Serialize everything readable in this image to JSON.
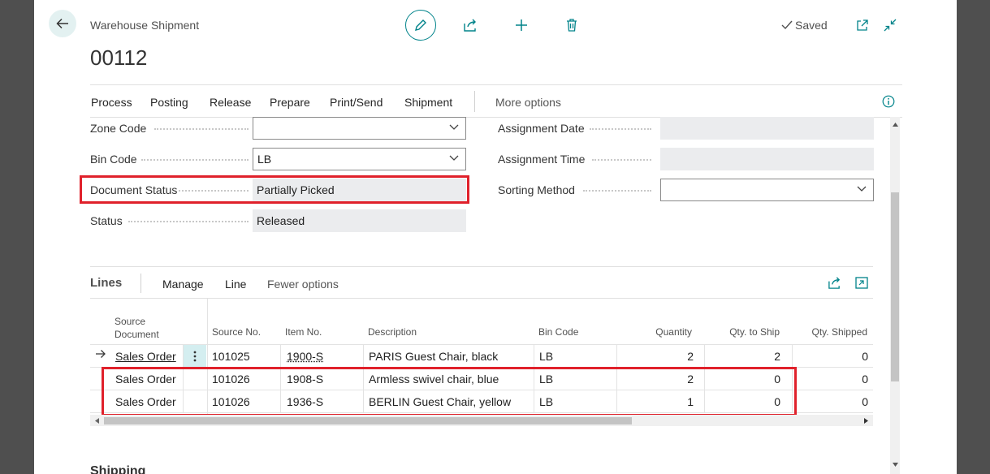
{
  "header": {
    "breadcrumb": "Warehouse Shipment",
    "document_no": "00112",
    "saved_label": "Saved"
  },
  "menu": {
    "items": [
      "Process",
      "Posting",
      "Release",
      "Prepare",
      "Print/Send",
      "Shipment"
    ],
    "more_options": "More options"
  },
  "fields": {
    "zone_code": {
      "label": "Zone Code",
      "value": ""
    },
    "bin_code": {
      "label": "Bin Code",
      "value": "LB"
    },
    "document_status": {
      "label": "Document Status",
      "value": "Partially Picked"
    },
    "status": {
      "label": "Status",
      "value": "Released"
    },
    "assignment_date": {
      "label": "Assignment Date",
      "value": ""
    },
    "assignment_time": {
      "label": "Assignment Time",
      "value": ""
    },
    "sorting_method": {
      "label": "Sorting Method",
      "value": ""
    }
  },
  "lines": {
    "title": "Lines",
    "actions": [
      "Manage",
      "Line",
      "Fewer options"
    ],
    "columns": {
      "source_document_1": "Source",
      "source_document_2": "Document",
      "source_no": "Source No.",
      "item_no": "Item No.",
      "description": "Description",
      "bin_code": "Bin Code",
      "quantity": "Quantity",
      "qty_to_ship": "Qty. to Ship",
      "qty_shipped": "Qty. Shipped"
    },
    "rows": [
      {
        "source_document": "Sales Order",
        "source_no": "101025",
        "item_no": "1900-S",
        "description": "PARIS Guest Chair, black",
        "bin_code": "LB",
        "quantity": "2",
        "qty_to_ship": "2",
        "qty_shipped": "0"
      },
      {
        "source_document": "Sales Order",
        "source_no": "101026",
        "item_no": "1908-S",
        "description": "Armless swivel chair, blue",
        "bin_code": "LB",
        "quantity": "2",
        "qty_to_ship": "0",
        "qty_shipped": "0"
      },
      {
        "source_document": "Sales Order",
        "source_no": "101026",
        "item_no": "1936-S",
        "description": "BERLIN Guest Chair, yellow",
        "bin_code": "LB",
        "quantity": "1",
        "qty_to_ship": "0",
        "qty_shipped": "0"
      }
    ]
  },
  "next_section": "Shipping",
  "colors": {
    "accent": "#00838a",
    "highlight": "#e0212b"
  }
}
